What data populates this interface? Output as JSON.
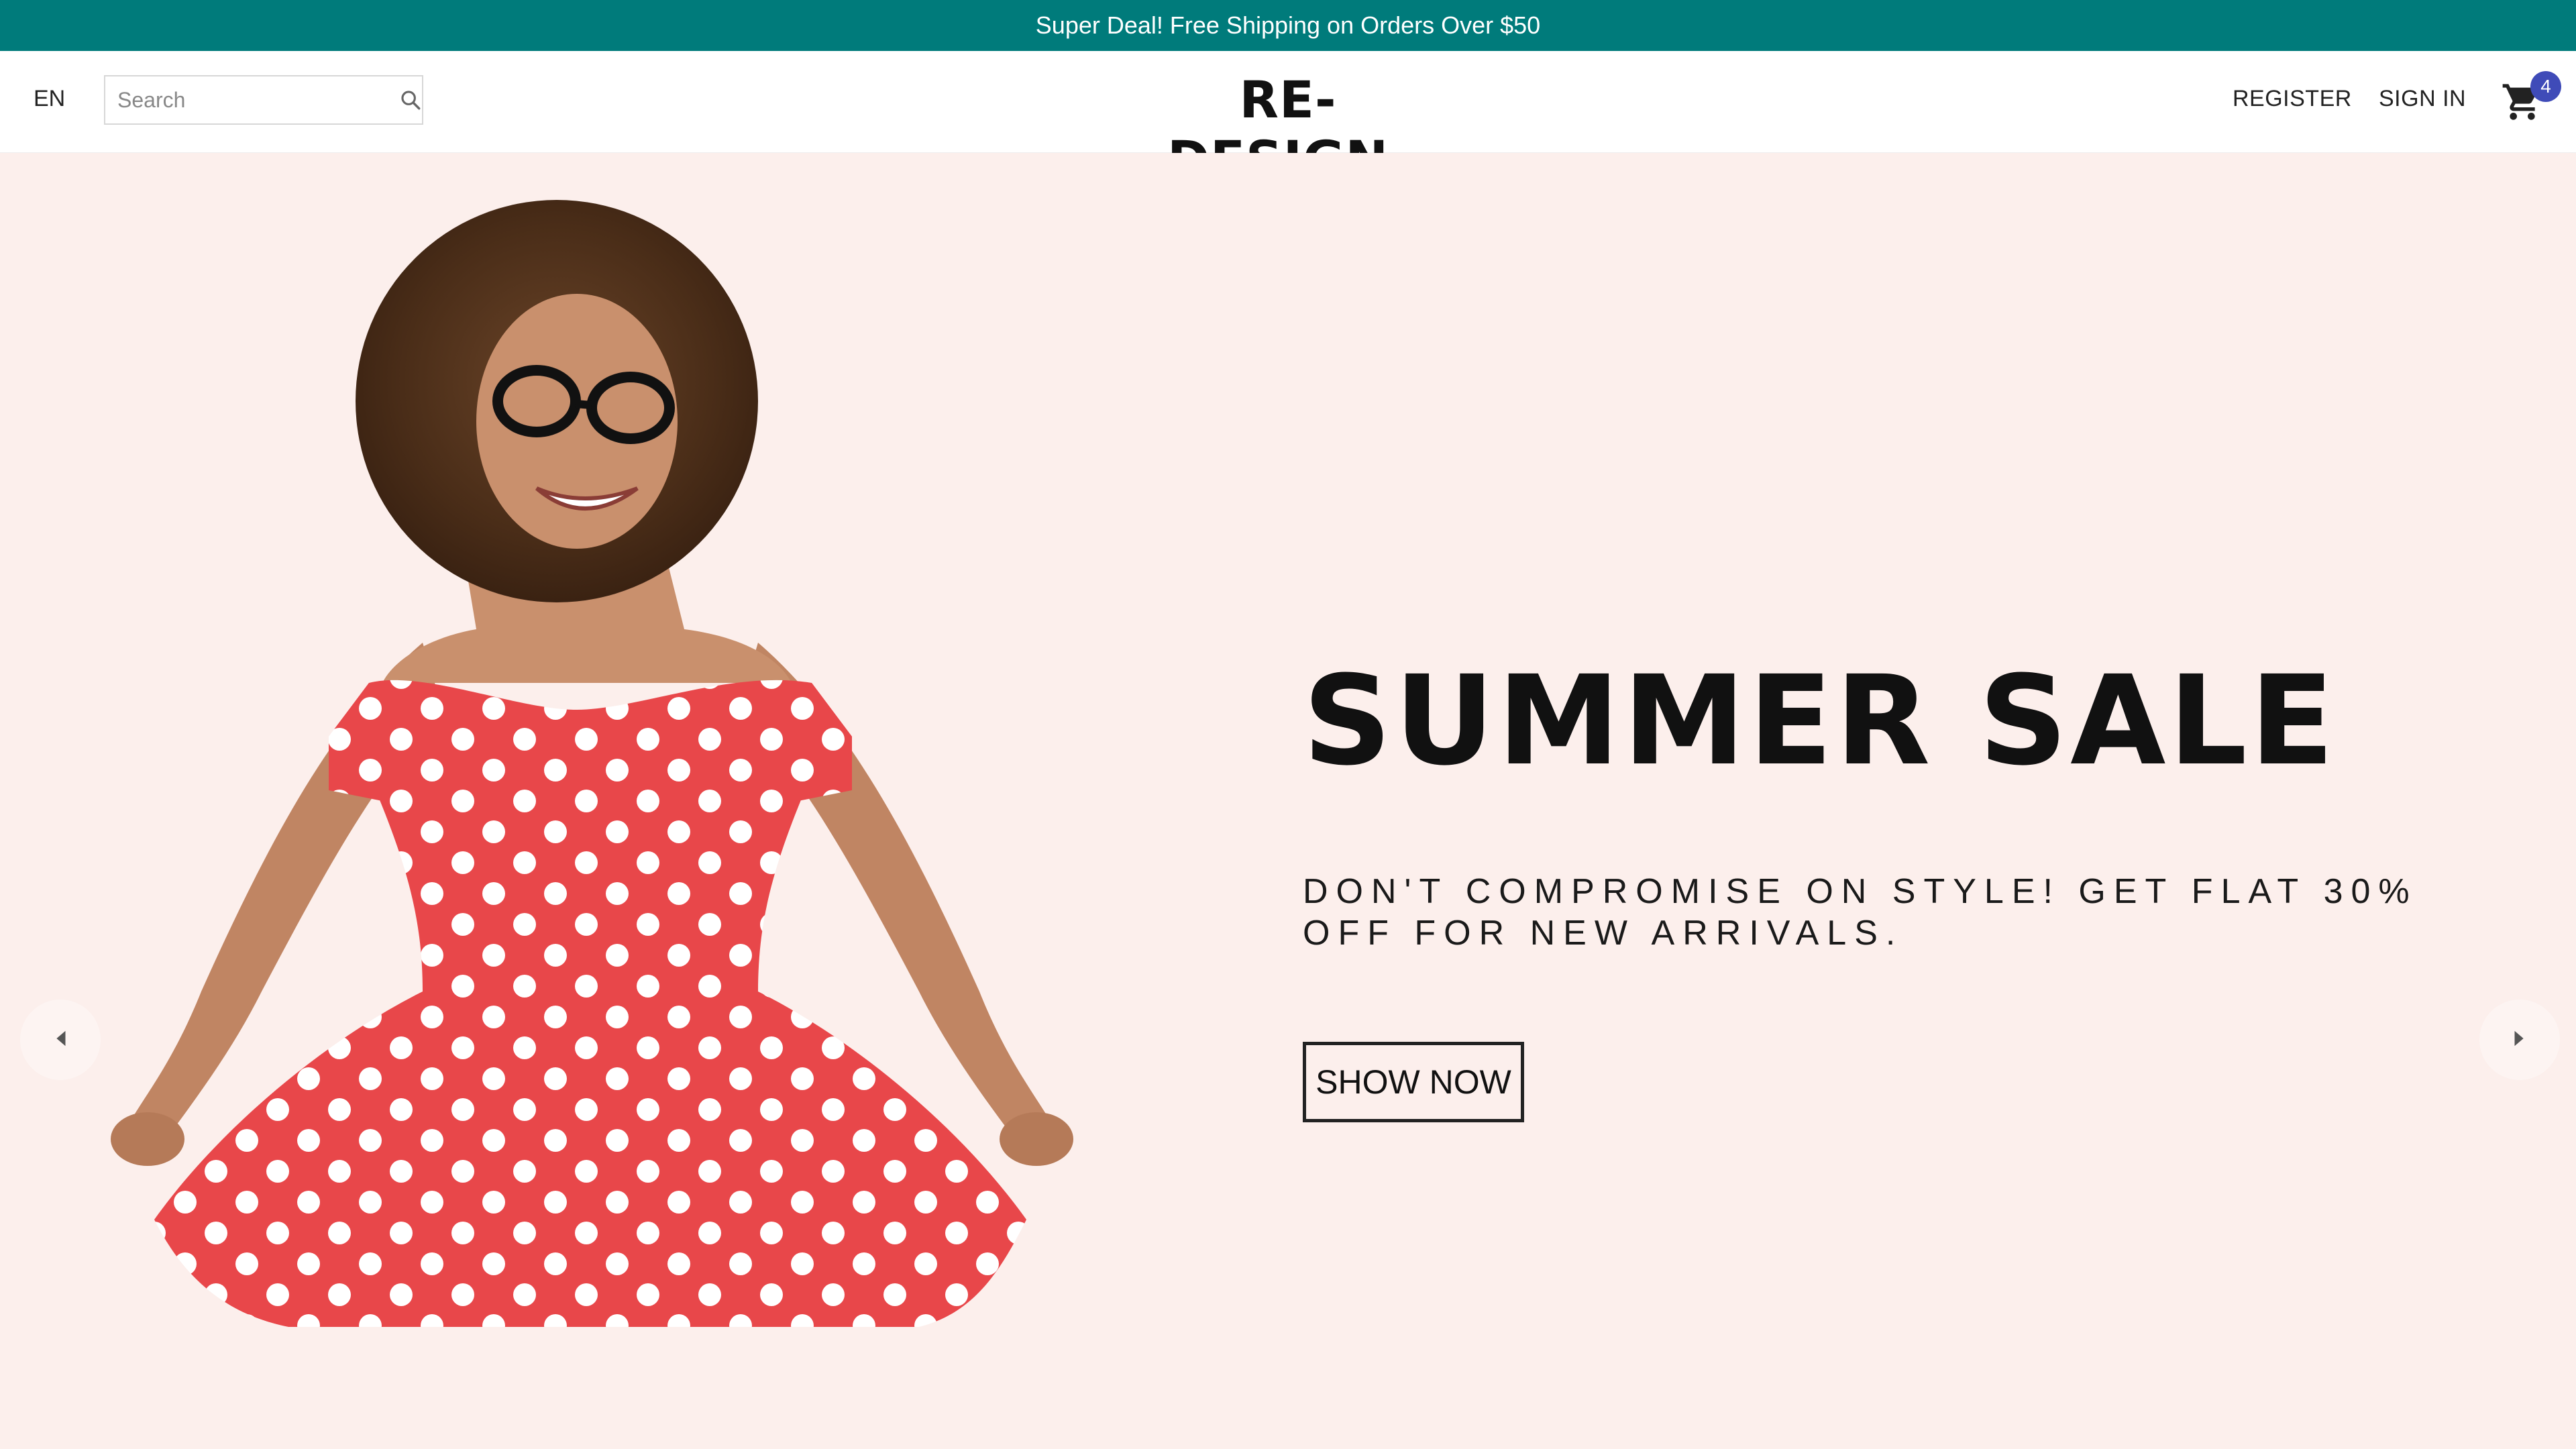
{
  "announcement": {
    "text": "Super Deal! Free Shipping on Orders Over $50"
  },
  "header": {
    "language": "EN",
    "search": {
      "placeholder": "Search",
      "value": ""
    },
    "logo": "RE-DESIGN.",
    "nav": {
      "register": "REGISTER",
      "sign_in": "SIGN IN"
    },
    "cart": {
      "count": "4"
    }
  },
  "hero": {
    "title": "SUMMER SALE",
    "subtitle": "DON'T COMPROMISE ON STYLE! GET FLAT 30% OFF FOR NEW ARRIVALS.",
    "cta": "SHOW NOW",
    "image_icon": "woman-in-polka-dot-dress",
    "prev_icon": "chevron-left-icon",
    "next_icon": "chevron-right-icon"
  },
  "colors": {
    "announcement_bg": "#007b7b",
    "hero_bg": "#fcefec",
    "badge": "#3f4bb8",
    "dress": "#e8474a"
  }
}
